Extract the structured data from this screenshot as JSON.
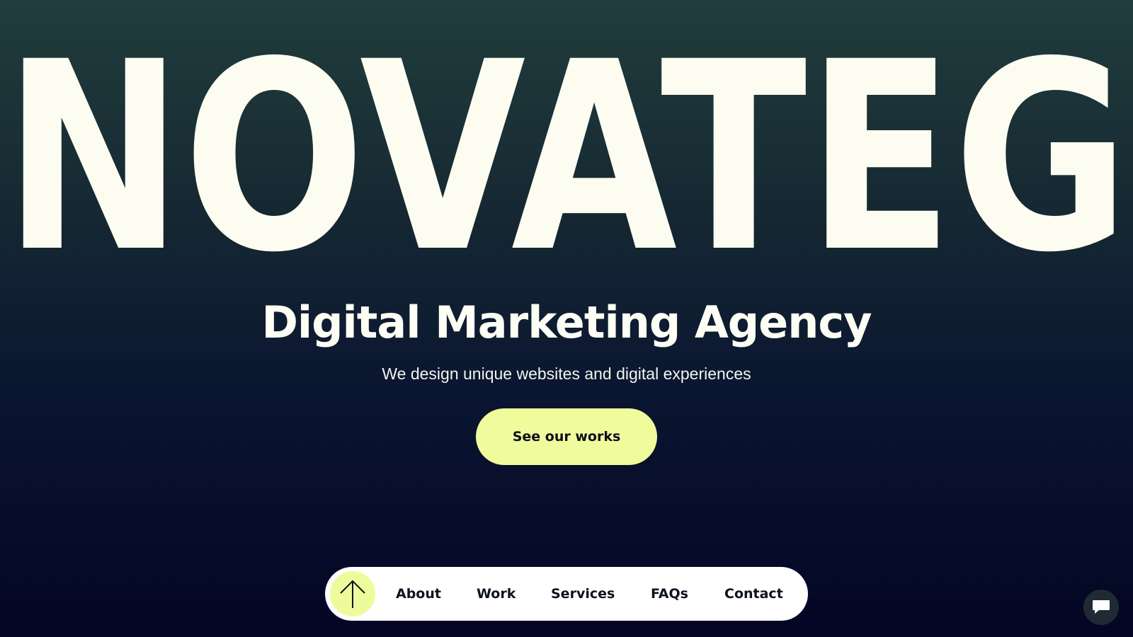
{
  "hero": {
    "wordmark": "NOVATEG",
    "headline": "Digital Marketing Agency",
    "subtitle": "We design unique websites and digital experiences",
    "cta_label": "See our works"
  },
  "nav": {
    "scroll_top_icon": "arrow-up-icon",
    "items": [
      {
        "label": "About"
      },
      {
        "label": "Work"
      },
      {
        "label": "Services"
      },
      {
        "label": "FAQs"
      },
      {
        "label": "Contact"
      }
    ]
  },
  "chat": {
    "icon": "chat-bubble-icon"
  },
  "colors": {
    "background_top": "#213d3d",
    "background_bottom": "#030624",
    "text_light": "#fdfff4",
    "accent": "#f0fb9c",
    "nav_bg": "#ffffff",
    "dark_text": "#0d1220"
  }
}
